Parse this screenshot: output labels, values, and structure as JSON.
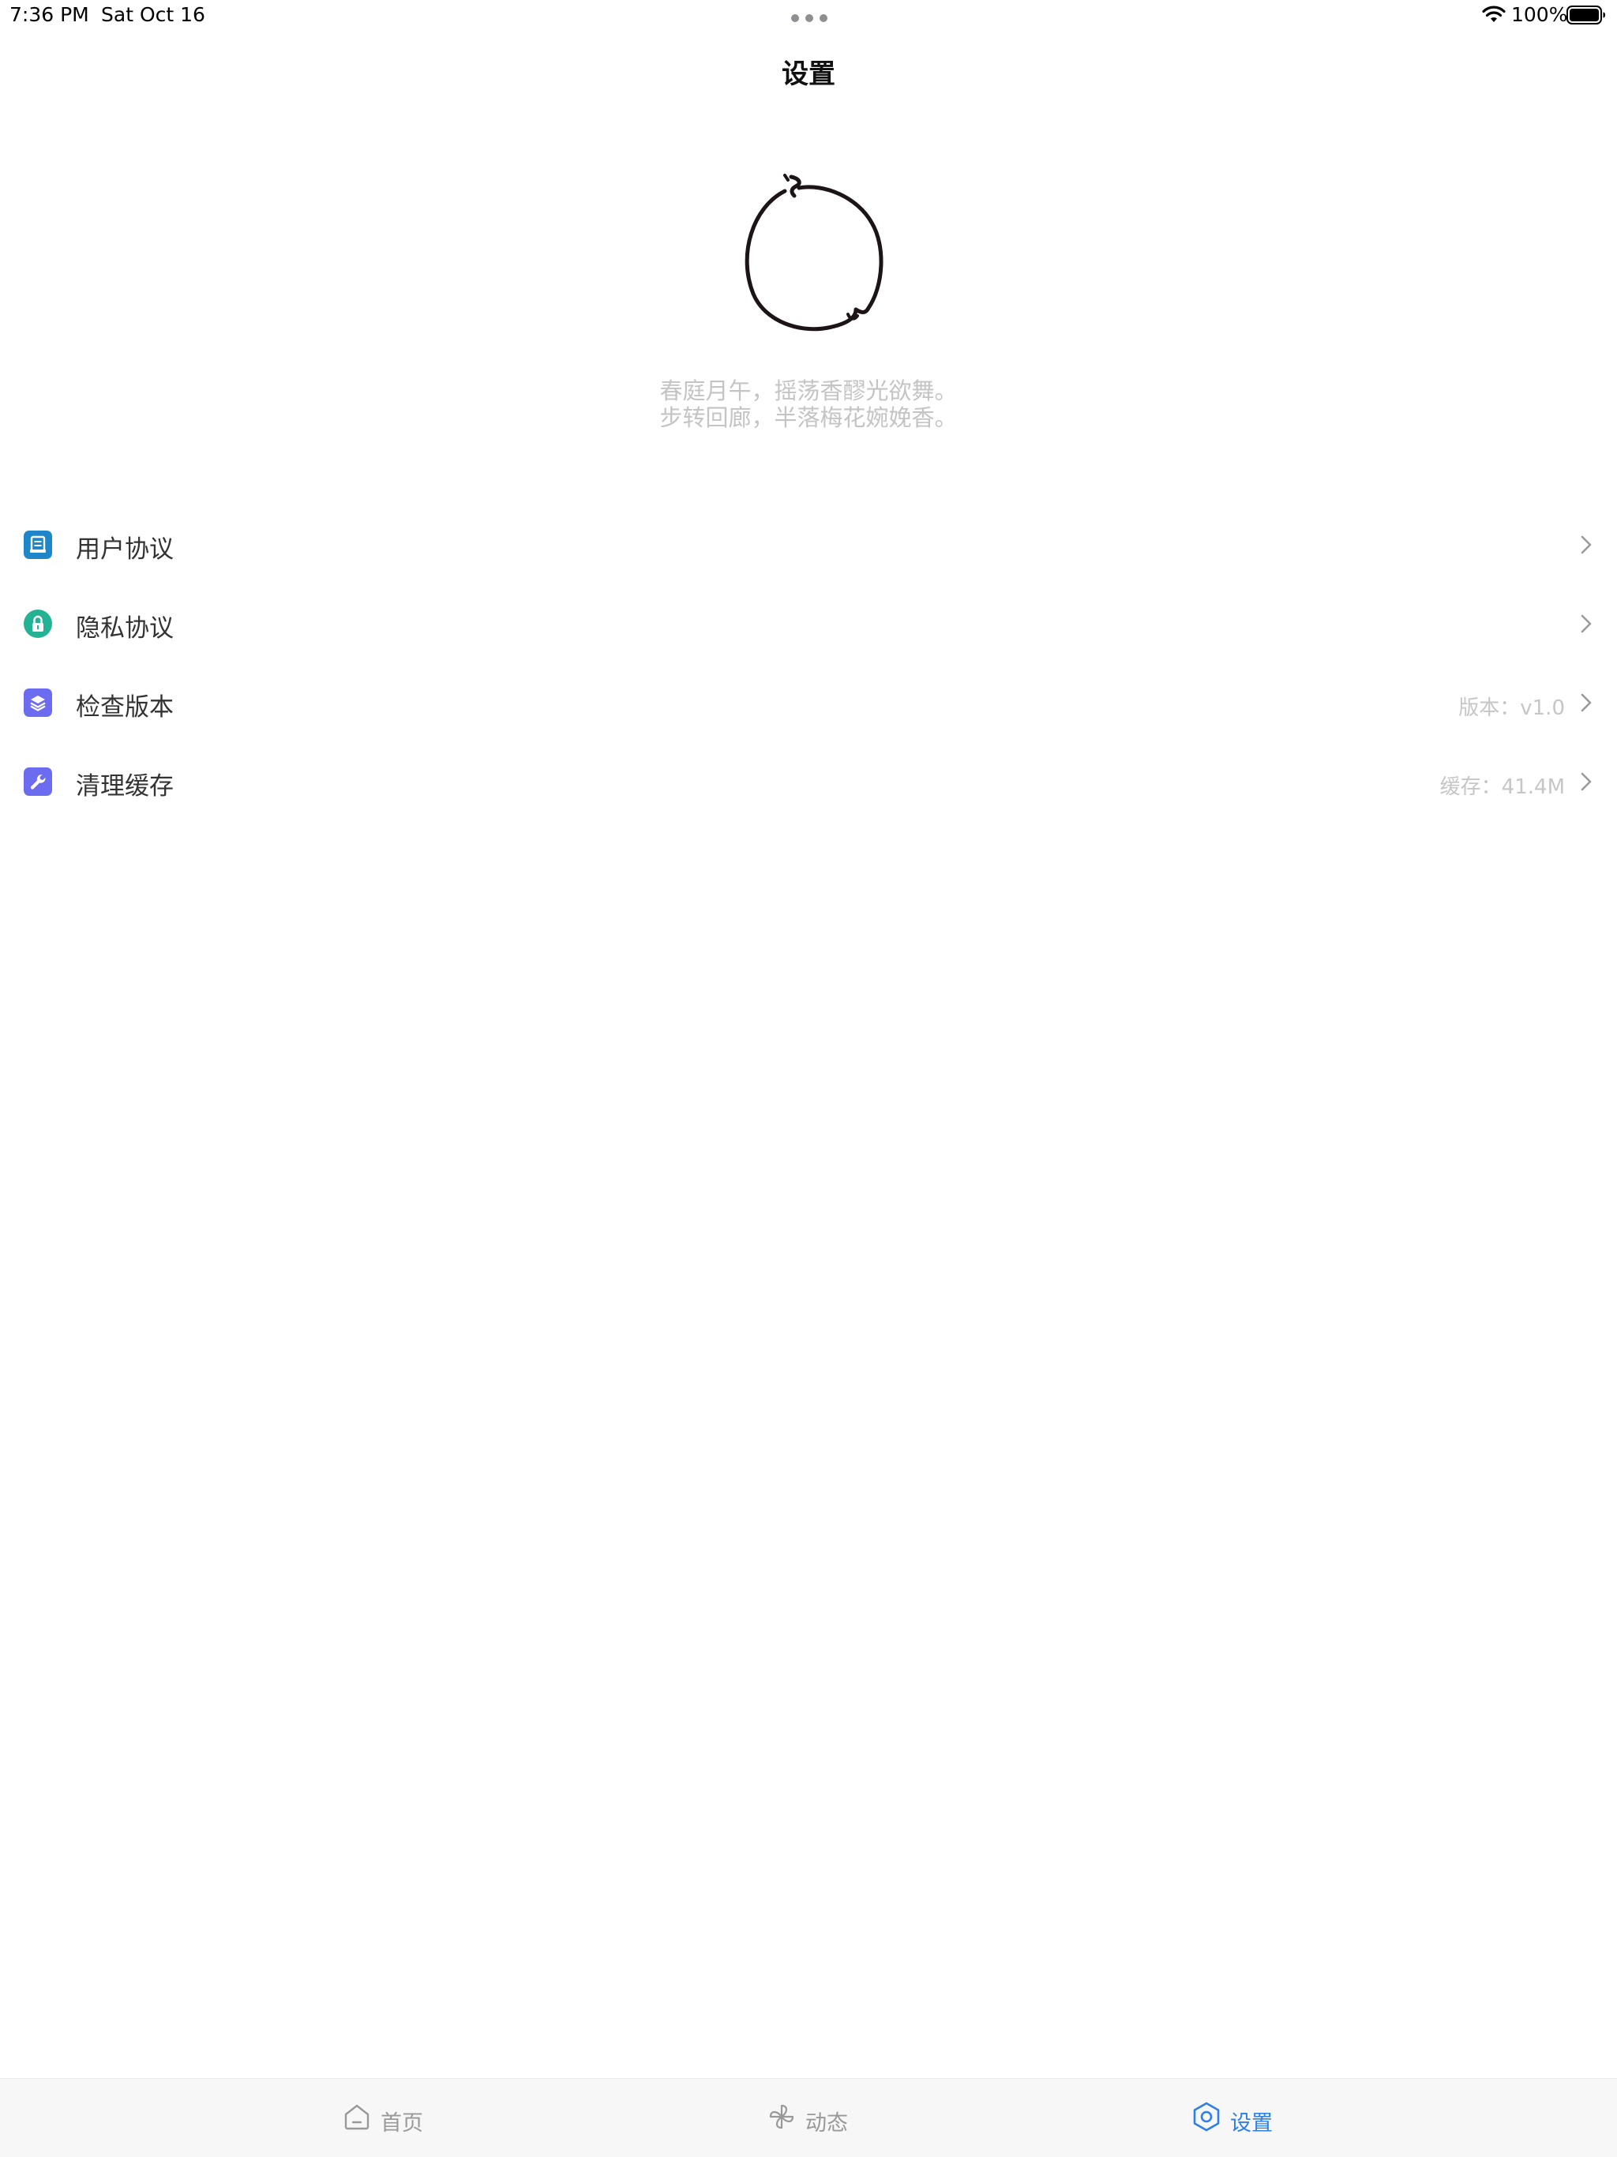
{
  "status_bar": {
    "time": "7:36 PM",
    "date": "Sat Oct 16",
    "battery_percent": "100%",
    "battery_level": 1.0
  },
  "nav": {
    "title": "设置"
  },
  "poem": {
    "line1": "春庭月午，摇荡香醪光欲舞。",
    "line2": "步转回廊，半落梅花婉娩香。"
  },
  "settings": {
    "items": [
      {
        "label": "用户协议",
        "detail": "",
        "icon": "document-icon",
        "color": "#1f86c9"
      },
      {
        "label": "隐私协议",
        "detail": "",
        "icon": "lock-icon",
        "color": "#23b293"
      },
      {
        "label": "检查版本",
        "detail": "版本：v1.0",
        "icon": "layers-icon",
        "color": "#6c6cf0"
      },
      {
        "label": "清理缓存",
        "detail": "缓存：41.4M",
        "icon": "wrench-icon",
        "color": "#6c6cf0"
      }
    ]
  },
  "tab_bar": {
    "tabs": [
      {
        "label": "首页",
        "icon": "home-icon",
        "active": false
      },
      {
        "label": "动态",
        "icon": "pinwheel-icon",
        "active": false
      },
      {
        "label": "设置",
        "icon": "hexagon-settings-icon",
        "active": true
      }
    ],
    "active_color": "#2f7fe8",
    "inactive_color": "#999999"
  }
}
